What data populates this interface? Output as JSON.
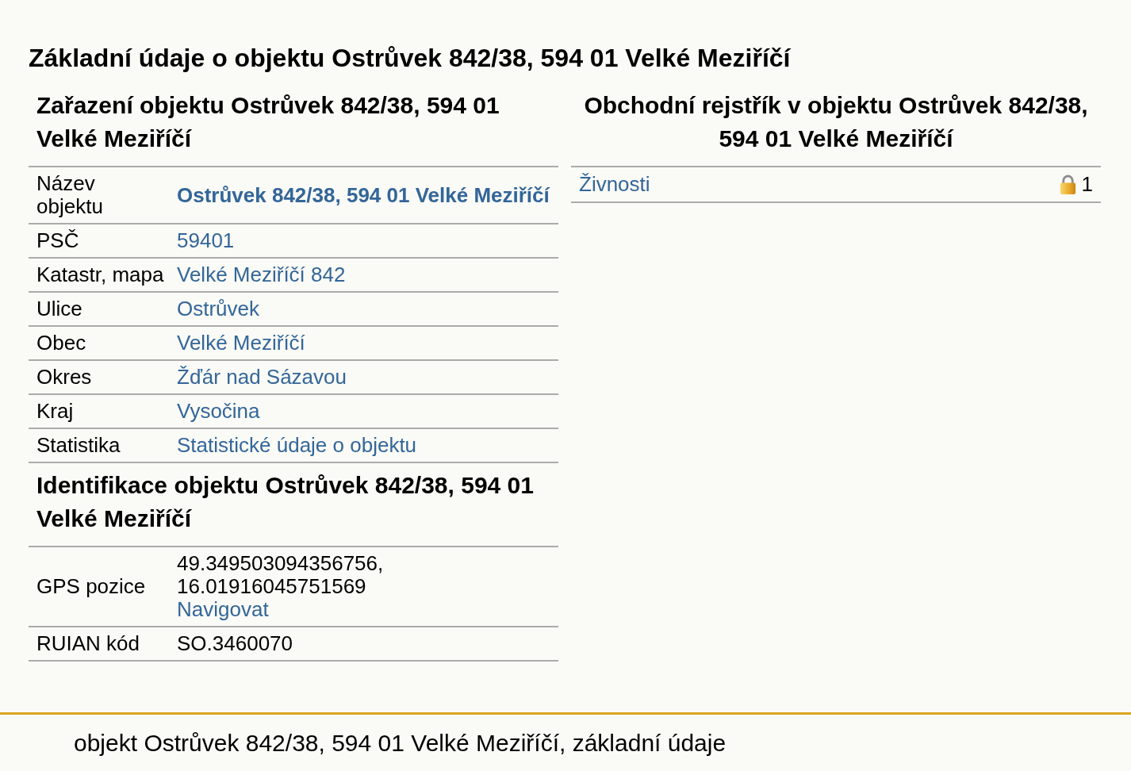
{
  "page_title": "Základní údaje o objektu Ostrůvek 842/38, 594 01 Velké Meziříčí",
  "classification": {
    "heading": "Zařazení objektu Ostrůvek 842/38, 594 01 Velké Meziříčí",
    "rows": [
      {
        "label": "Název objektu",
        "values": [
          {
            "kind": "strong_link",
            "text": "Ostrůvek 842/38, 594 01 Velké Meziříčí"
          }
        ]
      },
      {
        "label": "PSČ",
        "values": [
          {
            "kind": "link",
            "text": "59401"
          }
        ]
      },
      {
        "label": "Katastr, mapa",
        "values": [
          {
            "kind": "link",
            "text": "Velké Meziříčí 842"
          }
        ]
      },
      {
        "label": "Ulice",
        "values": [
          {
            "kind": "link",
            "text": "Ostrůvek"
          }
        ]
      },
      {
        "label": "Obec",
        "values": [
          {
            "kind": "link",
            "text": "Velké Meziříčí"
          }
        ]
      },
      {
        "label": "Okres",
        "values": [
          {
            "kind": "link",
            "text": "Žďár nad Sázavou"
          }
        ]
      },
      {
        "label": "Kraj",
        "values": [
          {
            "kind": "link",
            "text": "Vysočina"
          }
        ]
      },
      {
        "label": "Statistika",
        "values": [
          {
            "kind": "link",
            "text": "Statistické údaje o objektu"
          }
        ]
      }
    ]
  },
  "identification": {
    "heading": "Identifikace objektu Ostrůvek 842/38, 594 01 Velké Meziříčí",
    "rows": [
      {
        "label": "GPS pozice",
        "values": [
          {
            "kind": "text",
            "text": "49.349503094356756,"
          },
          {
            "kind": "text",
            "text": "16.01916045751569"
          },
          {
            "kind": "link",
            "text": "Navigovat"
          }
        ]
      },
      {
        "label": "RUIAN kód",
        "values": [
          {
            "kind": "text",
            "text": "SO.3460070"
          }
        ]
      }
    ]
  },
  "business_register": {
    "heading": "Obchodní rejstřík v objektu Ostrůvek 842/38, 594 01 Velké Meziříčí",
    "rows": [
      {
        "label": "Živnosti",
        "locked": true,
        "count": "1"
      }
    ]
  },
  "footer": "objekt Ostrůvek 842/38, 594 01 Velké Meziříčí, základní údaje"
}
